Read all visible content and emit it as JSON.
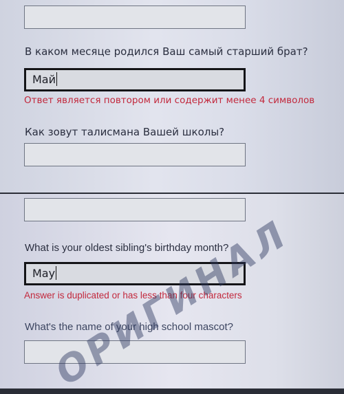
{
  "russian": {
    "question_month": "В каком месяце родился Ваш самый старший брат?",
    "answer_month": "Май",
    "error": "Ответ является повтором или содержит менее 4 символов",
    "question_mascot": "Как зовут талисмана Вашей школы?",
    "answer_mascot": ""
  },
  "english": {
    "question_month": "What is your oldest sibling's birthday month?",
    "answer_month": "May",
    "error": "Answer is duplicated or has less than four characters",
    "question_mascot": "What's the name of your high school mascot?",
    "answer_mascot": ""
  },
  "watermark": "ОРИГИНАЛ"
}
